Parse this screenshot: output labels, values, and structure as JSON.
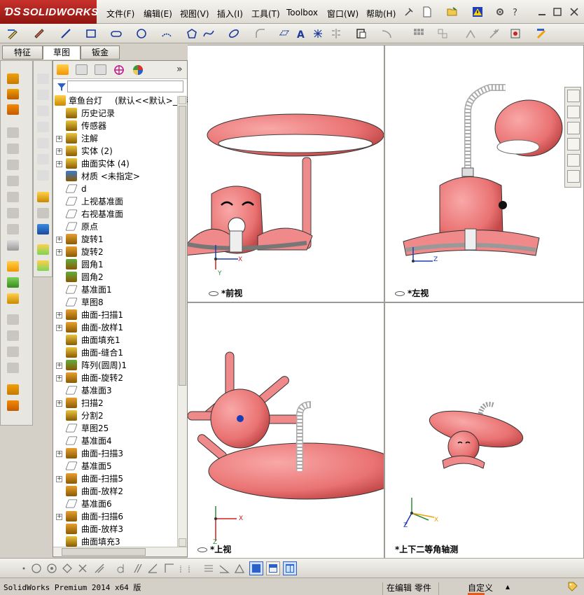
{
  "app": {
    "logo_brand": "SOLIDWORKS"
  },
  "menu": [
    "文件(F)",
    "编辑(E)",
    "视图(V)",
    "插入(I)",
    "工具(T)",
    "Toolbox",
    "窗口(W)",
    "帮助(H)"
  ],
  "tabs": [
    "特征",
    "草图",
    "钣金"
  ],
  "tree": {
    "root_label": "章鱼台灯",
    "root_config": "(默认<<默认>_显示",
    "filter_icon": "filter-icon",
    "items": [
      {
        "label": "历史记录",
        "expand": false,
        "icon": "history-icon",
        "color": "#e8c640"
      },
      {
        "label": "传感器",
        "expand": false,
        "icon": "sensor-icon",
        "color": "#e8c640"
      },
      {
        "label": "注解",
        "expand": true,
        "icon": "annotation-icon",
        "color": "#e8c640"
      },
      {
        "label": "实体 (2)",
        "expand": true,
        "icon": "solid-body-icon",
        "color": "#e8c640"
      },
      {
        "label": "曲面实体 (4)",
        "expand": true,
        "icon": "surface-body-icon",
        "color": "#e8c640"
      },
      {
        "label": "材质 <未指定>",
        "expand": false,
        "icon": "material-icon",
        "color": "#3a7acb"
      },
      {
        "label": "d",
        "expand": false,
        "icon": "plane-icon",
        "color": "#ffffff"
      },
      {
        "label": "上视基准面",
        "expand": false,
        "icon": "plane-icon",
        "color": "#ffffff"
      },
      {
        "label": "右视基准面",
        "expand": false,
        "icon": "plane-icon",
        "color": "#ffffff"
      },
      {
        "label": "原点",
        "expand": false,
        "icon": "origin-icon",
        "color": "#ffffff"
      },
      {
        "label": "旋转1",
        "expand": true,
        "icon": "revolve-icon",
        "color": "#e8a030"
      },
      {
        "label": "旋转2",
        "expand": true,
        "icon": "revolve-icon",
        "color": "#e8a030"
      },
      {
        "label": "圆角1",
        "expand": false,
        "icon": "fillet-icon",
        "color": "#5fae3f"
      },
      {
        "label": "圆角2",
        "expand": false,
        "icon": "fillet-icon",
        "color": "#5fae3f"
      },
      {
        "label": "基准面1",
        "expand": false,
        "icon": "plane-icon",
        "color": "#ffffff"
      },
      {
        "label": "草图8",
        "expand": false,
        "icon": "sketch-icon",
        "color": "#ffffff"
      },
      {
        "label": "曲面-扫描1",
        "expand": true,
        "icon": "sweep-icon",
        "color": "#e8a030"
      },
      {
        "label": "曲面-放样1",
        "expand": true,
        "icon": "loft-icon",
        "color": "#e8a030"
      },
      {
        "label": "曲面填充1",
        "expand": false,
        "icon": "fill-icon",
        "color": "#e8c640"
      },
      {
        "label": "曲面-缝合1",
        "expand": false,
        "icon": "knit-icon",
        "color": "#e8c640"
      },
      {
        "label": "阵列(圆周)1",
        "expand": true,
        "icon": "pattern-icon",
        "color": "#5fae3f"
      },
      {
        "label": "曲面-旋转2",
        "expand": true,
        "icon": "revolve-icon",
        "color": "#e8a030"
      },
      {
        "label": "基准面3",
        "expand": false,
        "icon": "plane-icon",
        "color": "#ffffff"
      },
      {
        "label": "扫描2",
        "expand": true,
        "icon": "sweep-icon",
        "color": "#e8a030"
      },
      {
        "label": "分割2",
        "expand": false,
        "icon": "split-icon",
        "color": "#e8c640"
      },
      {
        "label": "草图25",
        "expand": false,
        "icon": "sketch-icon",
        "color": "#ffffff"
      },
      {
        "label": "基准面4",
        "expand": false,
        "icon": "plane-icon",
        "color": "#ffffff"
      },
      {
        "label": "曲面-扫描3",
        "expand": true,
        "icon": "sweep-icon",
        "color": "#e8a030"
      },
      {
        "label": "基准面5",
        "expand": false,
        "icon": "plane-icon",
        "color": "#ffffff"
      },
      {
        "label": "曲面-扫描5",
        "expand": true,
        "icon": "sweep-icon",
        "color": "#e8a030"
      },
      {
        "label": "曲面-放样2",
        "expand": false,
        "icon": "loft-icon",
        "color": "#e8a030"
      },
      {
        "label": "基准面6",
        "expand": false,
        "icon": "plane-icon",
        "color": "#ffffff"
      },
      {
        "label": "曲面-扫描6",
        "expand": true,
        "icon": "sweep-icon",
        "color": "#e8a030"
      },
      {
        "label": "曲面-放样3",
        "expand": false,
        "icon": "loft-icon",
        "color": "#e8a030"
      },
      {
        "label": "曲面填充3",
        "expand": false,
        "icon": "fill-icon",
        "color": "#e8c640"
      }
    ]
  },
  "viewports": {
    "front": "*前视",
    "left": "*左视",
    "top": "*上视",
    "iso": "*上下二等角轴测"
  },
  "axes": {
    "x": "X",
    "y": "Y",
    "z": "Z"
  },
  "status": {
    "version": "SolidWorks Premium 2014 x64 版",
    "mode": "在编辑 零件",
    "custom": "自定义",
    "arrow": "▴"
  },
  "colors": {
    "model": "#f08080",
    "model_dark": "#d05a5a",
    "accent": "#c8312c"
  }
}
